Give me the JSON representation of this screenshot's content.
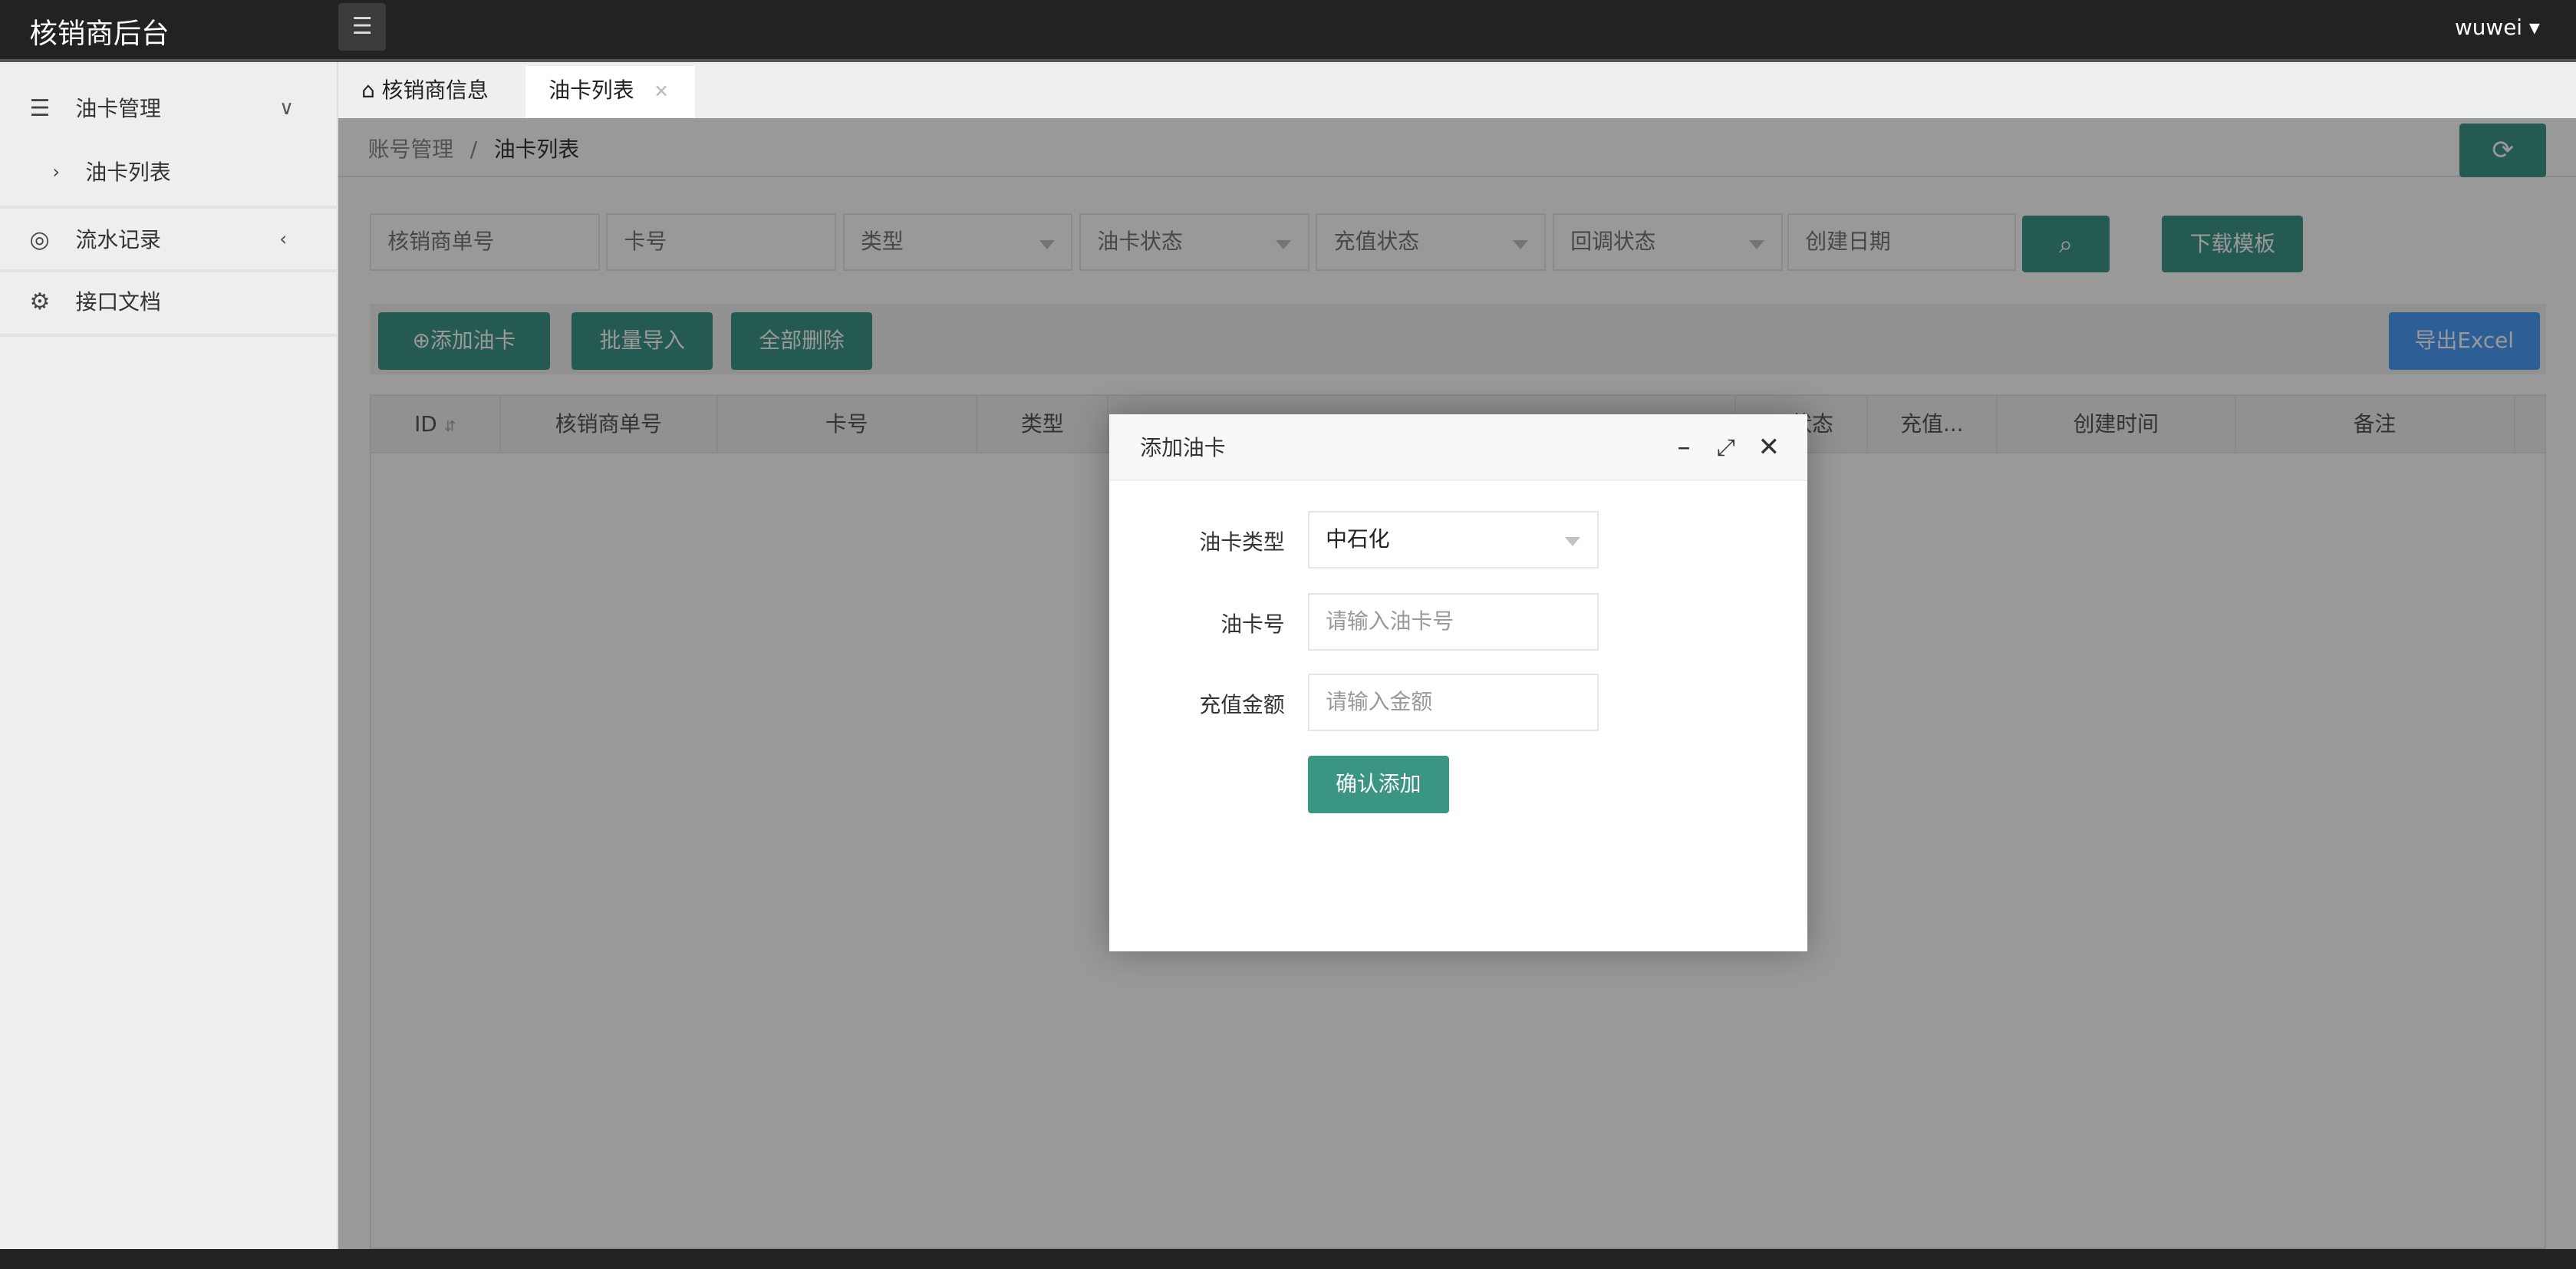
{
  "app_title": "核销商后台",
  "user": {
    "name": "wuwei"
  },
  "sidebar": {
    "items": [
      {
        "label": "油卡管理",
        "icon": "database-icon",
        "expanded": true
      },
      {
        "label": "油卡列表",
        "icon": "chevron-right-icon"
      },
      {
        "label": "流水记录",
        "icon": "clock-icon",
        "expanded": false
      },
      {
        "label": "接口文档",
        "icon": "gear-icon"
      }
    ]
  },
  "tabs": [
    {
      "label": "核销商信息",
      "icon": "home-icon"
    },
    {
      "label": "油卡列表",
      "active": true,
      "close": "✕"
    }
  ],
  "breadcrumb": {
    "parent": "账号管理",
    "sep": "/",
    "current": "油卡列表"
  },
  "filters": {
    "merchant_order": "核销商单号",
    "card_no": "卡号",
    "type": "类型",
    "card_status": "油卡状态",
    "recharge_status": "充值状态",
    "callback_status": "回调状态",
    "created_date": "创建日期",
    "download_template": "下载模板"
  },
  "toolbar": {
    "add": "添加油卡",
    "batch_import": "批量导入",
    "delete_all": "全部删除",
    "export": "导出Excel"
  },
  "table": {
    "headers": [
      "ID",
      "核销商单号",
      "卡号",
      "类型",
      "状态",
      "充值...",
      "创建时间",
      "备注"
    ]
  },
  "modal": {
    "title": "添加油卡",
    "card_type_label": "油卡类型",
    "card_type_value": "中石化",
    "card_no_label": "油卡号",
    "card_no_placeholder": "请输入油卡号",
    "amount_label": "充值金额",
    "amount_placeholder": "请输入金额",
    "submit": "确认添加"
  },
  "colors": {
    "primary": "#3f968a",
    "export": "#4b9ffa",
    "header": "#222222"
  }
}
